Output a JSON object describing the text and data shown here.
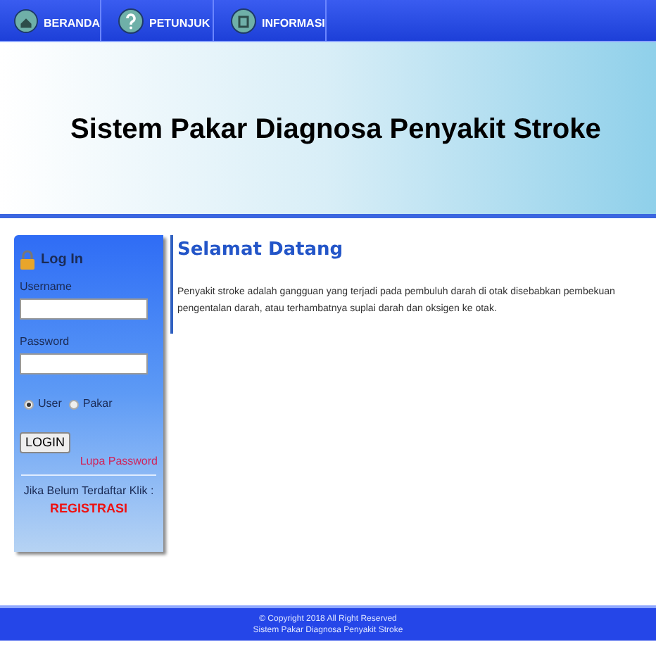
{
  "nav": [
    {
      "label": "BERANDA"
    },
    {
      "label": "PETUNJUK"
    },
    {
      "label": "INFORMASI"
    }
  ],
  "header": {
    "title": "Sistem Pakar Diagnosa Penyakit Stroke"
  },
  "login": {
    "title": "Log In",
    "username_label": "Username",
    "password_label": "Password",
    "roles": [
      {
        "label": "User",
        "selected": true
      },
      {
        "label": "Pakar",
        "selected": false
      }
    ],
    "button": "LOGIN",
    "forgot": "Lupa Password",
    "register_prompt": "Jika Belum Terdaftar Klik :",
    "register": "REGISTRASI"
  },
  "content": {
    "heading": "Selamat Datang",
    "lines": [
      "Penyakit stroke adalah gangguan yang terjadi pada pembuluh darah di otak disebabkan pembekuan",
      "pengentalan darah, atau terhambatnya suplai darah dan oksigen ke otak."
    ]
  },
  "footer": [
    "© Copyright 2018 All Right Reserved",
    "Sistem Pakar Diagnosa Penyakit Stroke"
  ]
}
